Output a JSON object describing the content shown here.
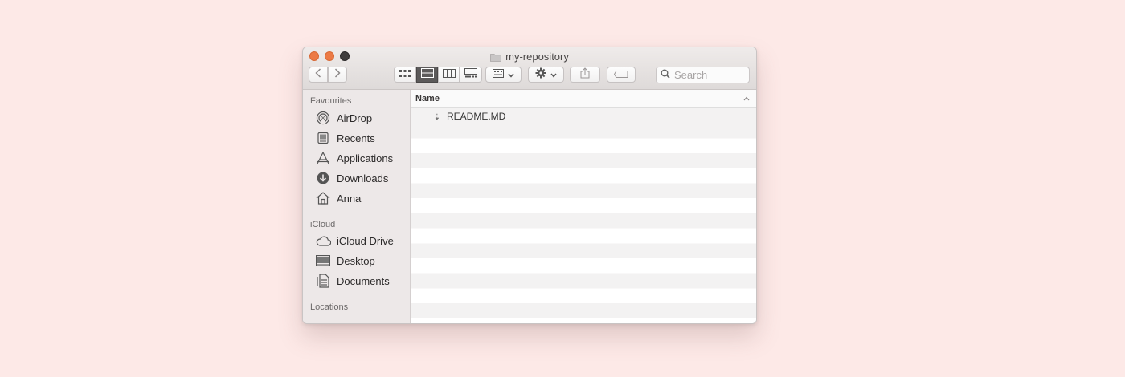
{
  "window": {
    "title": "my-repository",
    "title_icon": "folder-icon"
  },
  "toolbar": {
    "back_icon": "chevron-left-icon",
    "forward_icon": "chevron-right-icon",
    "view_modes": [
      "icon-view",
      "list-view",
      "column-view",
      "gallery-view"
    ],
    "active_view": "list-view",
    "group_icon": "group-by-icon",
    "action_icon": "gear-icon",
    "share_icon": "share-icon",
    "tag_icon": "tag-icon",
    "search_placeholder": "Search"
  },
  "sidebar": {
    "sections": [
      {
        "title": "Favourites",
        "items": [
          {
            "label": "AirDrop",
            "icon": "airdrop-icon"
          },
          {
            "label": "Recents",
            "icon": "recents-icon"
          },
          {
            "label": "Applications",
            "icon": "applications-icon"
          },
          {
            "label": "Downloads",
            "icon": "downloads-icon"
          },
          {
            "label": "Anna",
            "icon": "home-icon"
          }
        ]
      },
      {
        "title": "iCloud",
        "items": [
          {
            "label": "iCloud Drive",
            "icon": "cloud-icon"
          },
          {
            "label": "Desktop",
            "icon": "desktop-icon"
          },
          {
            "label": "Documents",
            "icon": "documents-icon"
          }
        ]
      },
      {
        "title": "Locations",
        "items": []
      }
    ]
  },
  "file_list": {
    "column_header": "Name",
    "sort": "ascending",
    "files": [
      {
        "name": "README.MD",
        "icon": "markdown-file-icon"
      }
    ]
  },
  "colors": {
    "background": "#fde9e7",
    "traffic_close": "#ec7a45",
    "traffic_minimize": "#ec7a45",
    "traffic_zoom": "#3f3d3d",
    "sidebar": "#ede8e8"
  }
}
